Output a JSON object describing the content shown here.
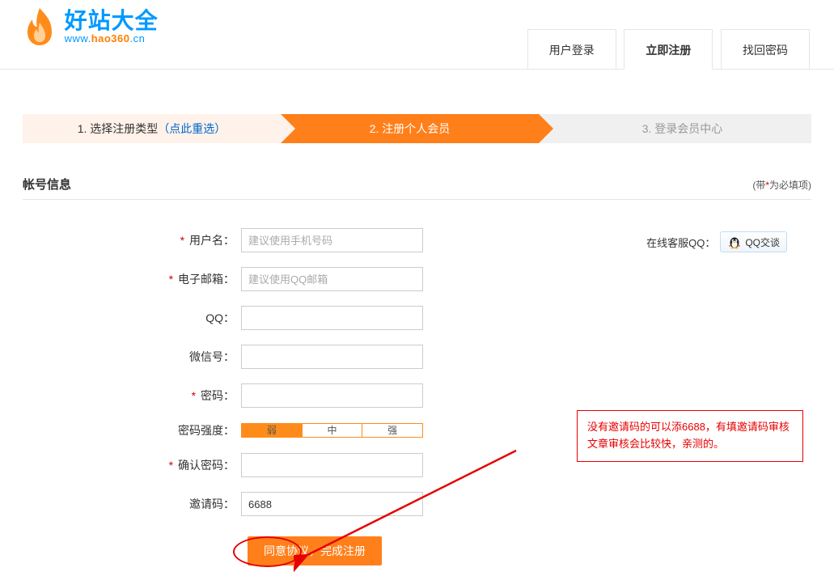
{
  "logo": {
    "cn": "好站大全",
    "url_prefix": "www.",
    "url_mid": "hao360",
    "url_suffix": ".cn"
  },
  "nav": {
    "login": "用户登录",
    "register": "立即注册",
    "recover": "找回密码"
  },
  "steps": {
    "s1_pre": "1. 选择注册类型",
    "s1_link": "（点此重选）",
    "s2": "2. 注册个人会员",
    "s3": "3. 登录会员中心"
  },
  "section": {
    "title": "帐号信息",
    "note_pre": "(带",
    "note_star": "*",
    "note_post": "为必填项)"
  },
  "form": {
    "username": {
      "label": "用户名",
      "placeholder": "建议使用手机号码"
    },
    "email": {
      "label": "电子邮箱",
      "placeholder": "建议使用QQ邮箱"
    },
    "qq": {
      "label": "QQ"
    },
    "wechat": {
      "label": "微信号"
    },
    "password": {
      "label": "密码"
    },
    "strength": {
      "label": "密码强度",
      "weak": "弱",
      "mid": "中",
      "strong": "强"
    },
    "confirm": {
      "label": "确认密码"
    },
    "invite": {
      "label": "邀请码",
      "value": "6688"
    }
  },
  "service": {
    "label": "在线客服QQ：",
    "btn": "QQ交谈"
  },
  "annotation": "没有邀请码的可以添6688，有填邀请码审核文章审核会比较快，亲测的。",
  "submit": "同意协议，完成注册",
  "colon": "："
}
